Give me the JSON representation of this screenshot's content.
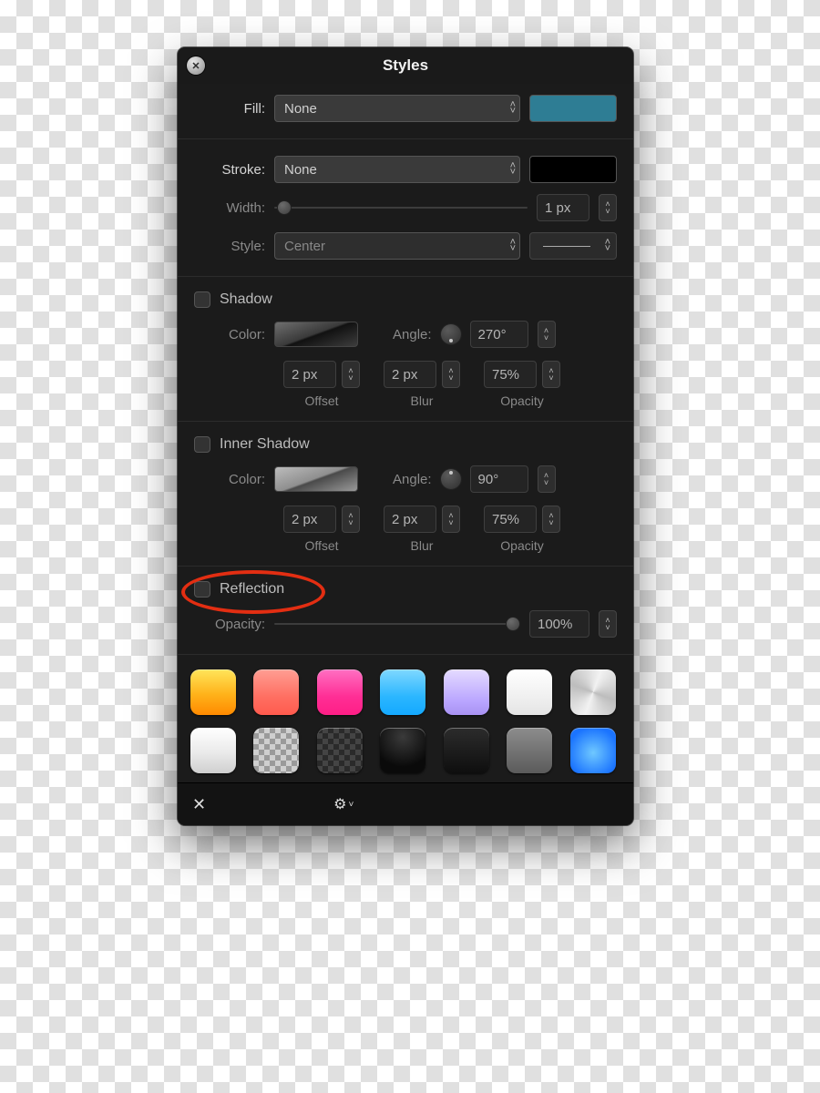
{
  "title": "Styles",
  "fill": {
    "label": "Fill:",
    "value": "None",
    "swatch_color": "#2e7d94"
  },
  "stroke": {
    "label": "Stroke:",
    "value": "None",
    "swatch_color": "#000000",
    "width_label": "Width:",
    "width_value": "1 px",
    "style_label": "Style:",
    "style_value": "Center"
  },
  "shadow": {
    "label": "Shadow",
    "checked": false,
    "color_label": "Color:",
    "angle_label": "Angle:",
    "angle_value": "270°",
    "offset_value": "2 px",
    "offset_label": "Offset",
    "blur_value": "2 px",
    "blur_label": "Blur",
    "opacity_value": "75%",
    "opacity_label": "Opacity"
  },
  "inner_shadow": {
    "label": "Inner Shadow",
    "checked": false,
    "color_label": "Color:",
    "angle_label": "Angle:",
    "angle_value": "90°",
    "offset_value": "2 px",
    "offset_label": "Offset",
    "blur_value": "2 px",
    "blur_label": "Blur",
    "opacity_value": "75%",
    "opacity_label": "Opacity"
  },
  "reflection": {
    "label": "Reflection",
    "checked": false,
    "opacity_label": "Opacity:",
    "opacity_value": "100%",
    "highlighted": true
  },
  "presets": [
    {
      "id": "orange-gloss",
      "bg": "linear-gradient(180deg,#ffe55a 0%,#ffb21a 55%,#ff8a00 100%)"
    },
    {
      "id": "coral-gloss",
      "bg": "linear-gradient(180deg,#ff9e93 0%,#ff6f62 60%,#ff5a4d 100%)"
    },
    {
      "id": "magenta-gloss",
      "bg": "linear-gradient(180deg,#ff6fc2 0%,#ff2e95 60%,#ff1e86 100%)"
    },
    {
      "id": "sky-gloss",
      "bg": "linear-gradient(180deg,#7fd8ff 0%,#2bb6ff 60%,#14a9ff 100%)"
    },
    {
      "id": "lilac-gloss",
      "bg": "linear-gradient(180deg,#e5dbff 0%,#b9a5ff 70%,#a892f2 100%)"
    },
    {
      "id": "white-gloss",
      "bg": "linear-gradient(180deg,#ffffff 0%,#f0f0f0 60%,#e4e4e4 100%)"
    },
    {
      "id": "brushed-metal",
      "bg": "conic-gradient(from 200deg,#f2f2f2,#bdbdbd,#f2f2f2,#bdbdbd,#f2f2f2)"
    },
    {
      "id": "white-beveled",
      "bg": "linear-gradient(180deg,#ffffff 0%,#eaeaea 55%,#cfcfcf 100%)"
    },
    {
      "id": "checker-opaque",
      "class": "mini-checker"
    },
    {
      "id": "checker-dark",
      "class": "faded-checker"
    },
    {
      "id": "black-fade",
      "bg": "radial-gradient(circle at 50% 20%,#3a3a3a,#0a0a0a 70%)"
    },
    {
      "id": "black-flat",
      "bg": "linear-gradient(180deg,#2c2c2c,#0e0e0e)"
    },
    {
      "id": "grey-button",
      "bg": "linear-gradient(180deg,#8d8d8d,#5b5b5b)"
    },
    {
      "id": "blue-glow",
      "bg": "radial-gradient(circle at 50% 55%,#6fc8ff,#1b74ff 75%)"
    }
  ]
}
